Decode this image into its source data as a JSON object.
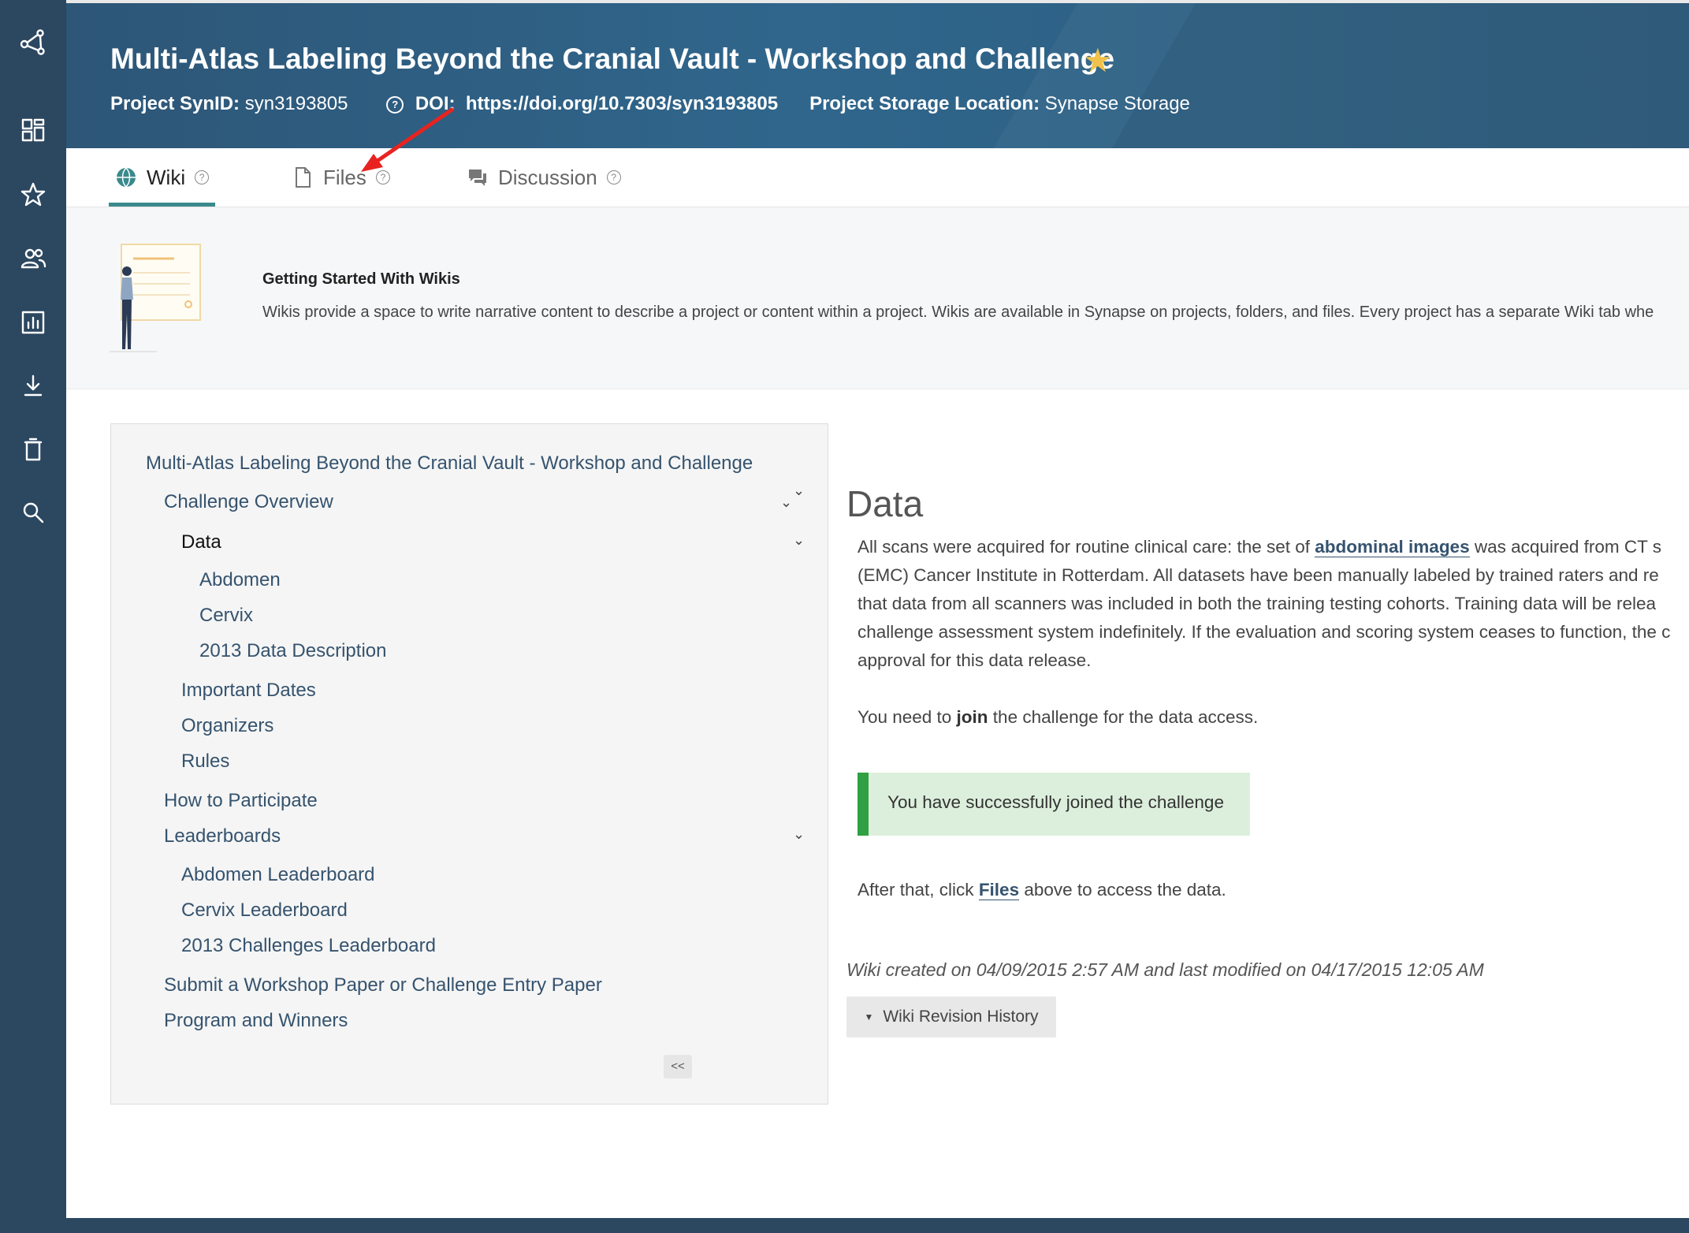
{
  "header": {
    "title": "Multi-Atlas Labeling Beyond the Cranial Vault - Workshop and Challenge",
    "synid_label": "Project SynID:",
    "synid_value": "syn3193805",
    "doi_label": "DOI:",
    "doi_value": "https://doi.org/10.7303/syn3193805",
    "storage_label": "Project Storage Location:",
    "storage_value": "Synapse Storage"
  },
  "rail": {
    "icons": [
      "synapse-logo-icon",
      "dashboard-icon",
      "favorites-star-icon",
      "teams-icon",
      "challenges-chart-icon",
      "download-icon",
      "trash-icon",
      "search-icon"
    ]
  },
  "tabs": [
    {
      "label": "Wiki",
      "icon": "globe-icon",
      "active": true
    },
    {
      "label": "Files",
      "icon": "file-icon",
      "active": false
    },
    {
      "label": "Discussion",
      "icon": "discussion-icon",
      "active": false
    }
  ],
  "banner": {
    "title": "Getting Started With Wikis",
    "text": "Wikis provide a space to write narrative content to describe a project or content within a project. Wikis are available in Synapse on projects, folders, and files. Every project has a separate Wiki tab whe"
  },
  "wiki_nav": {
    "root": "Multi-Atlas Labeling Beyond the Cranial Vault - Workshop and Challenge",
    "challenge_overview": "Challenge Overview",
    "data": "Data",
    "abdomen": "Abdomen",
    "cervix": "Cervix",
    "data_desc_2013": "2013 Data Description",
    "important_dates": "Important Dates",
    "organizers": "Organizers",
    "rules": "Rules",
    "how_to_participate": "How to Participate",
    "leaderboards": "Leaderboards",
    "abdomen_leaderboard": "Abdomen Leaderboard",
    "cervix_leaderboard": "Cervix Leaderboard",
    "challenges_leaderboard_2013": "2013 Challenges Leaderboard",
    "submit_paper": "Submit a Workshop Paper or Challenge Entry Paper",
    "program_winners": "Program and Winners",
    "collapse_label": "<<"
  },
  "content": {
    "heading": "Data",
    "line1_pre": "All scans were acquired for routine clinical care: the set of ",
    "line1_link": "abdominal images",
    "line1_post": " was acquired from CT s",
    "line2": "(EMC) Cancer Institute in Rotterdam. All datasets have been manually labeled by trained raters and re",
    "line3": "that data from all scanners was included in both the training testing cohorts. Training data will be relea",
    "line4": "challenge assessment system indefinitely. If the evaluation and scoring system ceases to function, the c",
    "line5": "approval for this data release.",
    "join_pre": "You need to ",
    "join_bold": "join",
    "join_post": " the challenge for the data access.",
    "success_msg": "You have successfully joined the challenge",
    "after_pre": "After that, click ",
    "after_link": "Files",
    "after_post": " above to access the data.",
    "created": "Wiki created on  04/09/2015 2:57 AM  and last modified on  04/17/2015 12:05 AM",
    "revision_button": "Wiki Revision History"
  },
  "colors": {
    "rail": "#2c4760",
    "header": "#30668c",
    "star": "#f0c24b",
    "link": "#35536e",
    "success_bar": "#2fa043",
    "annotation_arrow": "#e8231f"
  }
}
